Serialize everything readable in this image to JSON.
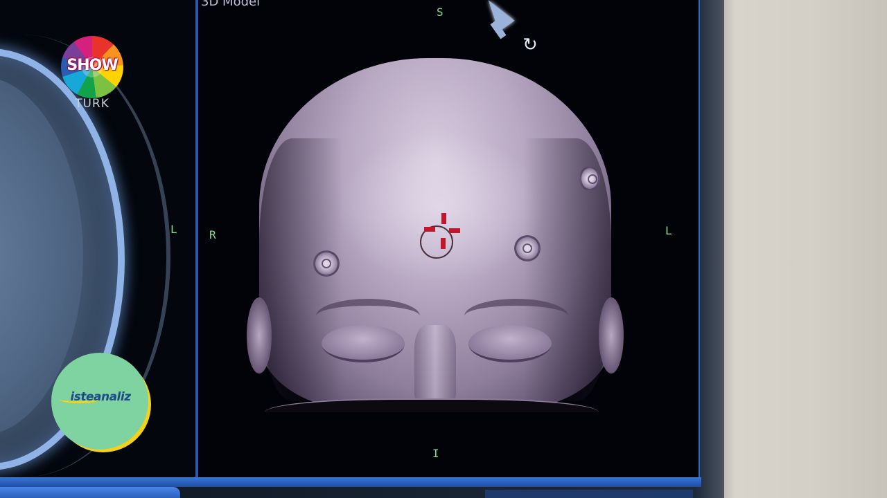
{
  "viewer": {
    "view_title": "3D Model",
    "orientation": {
      "top": "S",
      "bottom": "I",
      "left": "R",
      "right": "L",
      "axial_right": "L"
    }
  },
  "overlay": {
    "channel_logo": {
      "word": "SHOW",
      "sub": "TURK"
    },
    "program_badge": {
      "text_part1": "iste",
      "text_part2": "analiz"
    }
  },
  "icons": {
    "cursor": "arrow-cursor-icon",
    "rotate": "rotate-icon",
    "target": "crosshair-target-icon"
  },
  "colors": {
    "orientation_label": "#7ee08a",
    "screen_frame": "#2f67c9",
    "crosshair": "#c0182a",
    "badge_fill": "#7fd3a0",
    "badge_accent": "#f3d21c"
  }
}
